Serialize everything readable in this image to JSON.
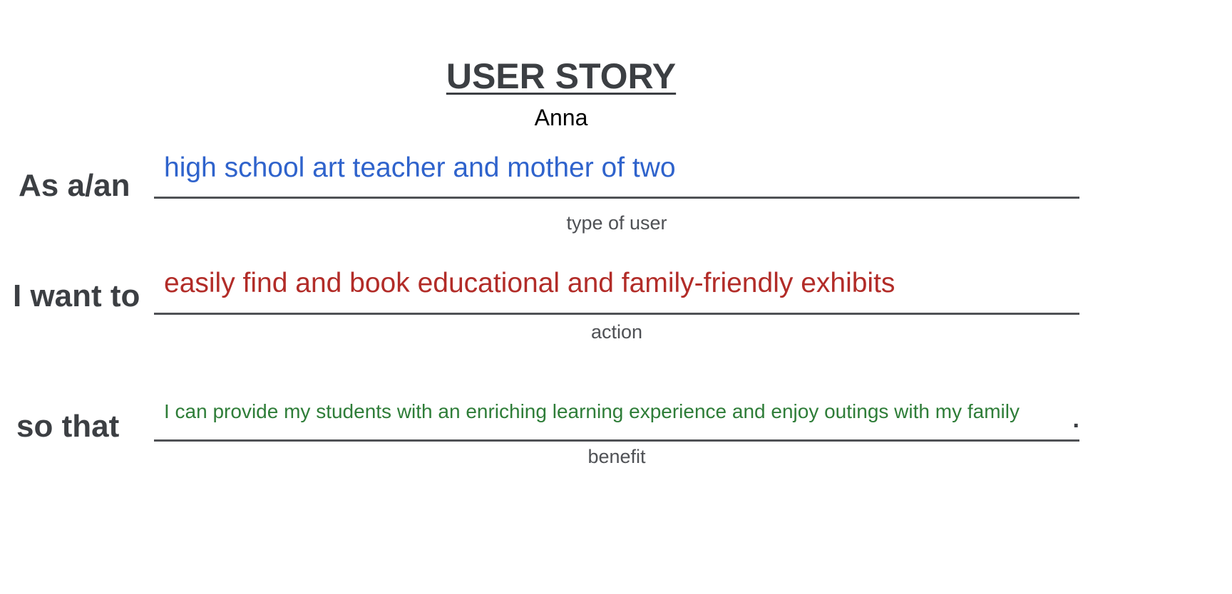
{
  "story": {
    "title": "USER STORY",
    "persona_name": "Anna"
  },
  "rows": [
    {
      "label": "As a/an",
      "value": "high school art teacher and mother of two",
      "caption": "type of user",
      "value_color": "#2f63cc"
    },
    {
      "label": "I want to",
      "value": "easily find and book educational and family-friendly exhibits",
      "caption": "action",
      "value_color": "#b22c28"
    },
    {
      "label": "so that",
      "value": "I can provide my students with an enriching learning experience and enjoy outings with my family",
      "caption": "benefit",
      "value_color": "#2e7d38",
      "trailing": "."
    }
  ],
  "colors": {
    "label_text": "#3c3f43",
    "underline": "#4f5155"
  }
}
